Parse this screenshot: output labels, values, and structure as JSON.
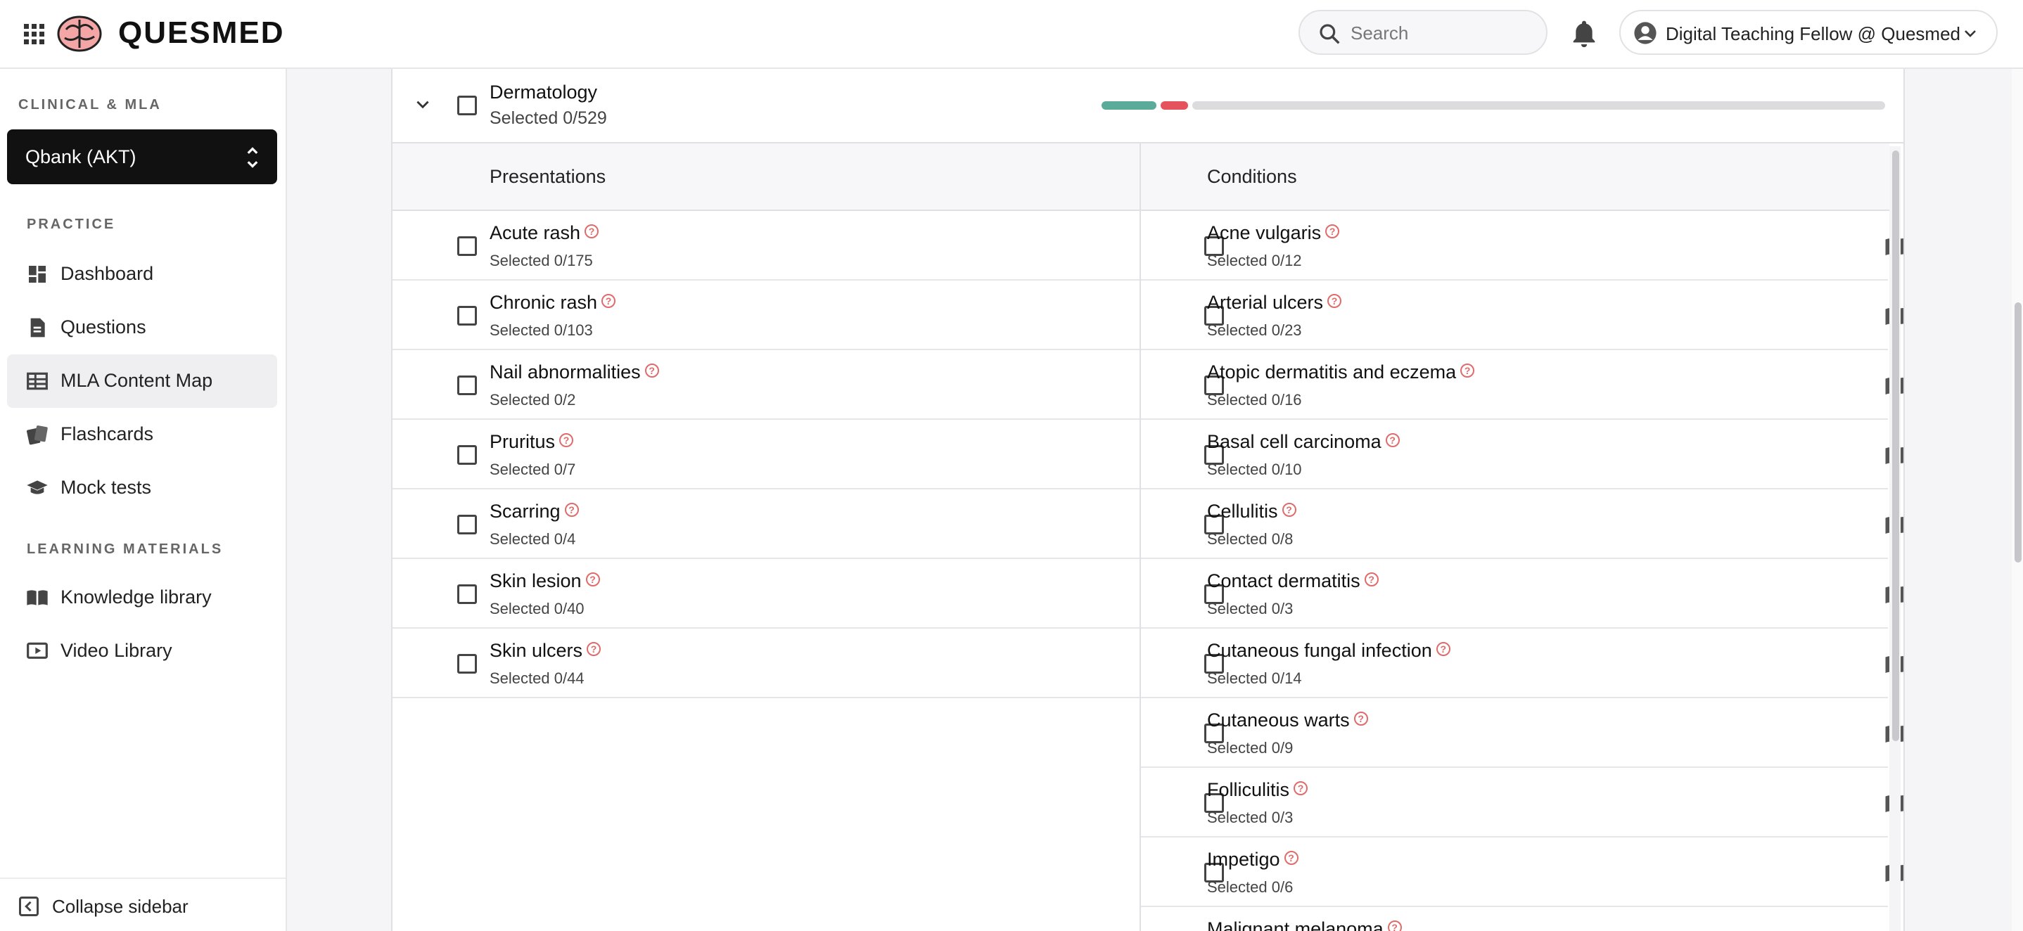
{
  "header": {
    "brand": "QUESMED",
    "search_placeholder": "Search",
    "account_label": "Digital Teaching Fellow @ Quesmed"
  },
  "sidebar": {
    "section_clinical": "CLINICAL & MLA",
    "qbank_label": "Qbank (AKT)",
    "section_practice": "PRACTICE",
    "practice_items": [
      {
        "label": "Dashboard",
        "icon": "dashboard-icon"
      },
      {
        "label": "Questions",
        "icon": "document-icon"
      },
      {
        "label": "MLA Content Map",
        "icon": "table-icon",
        "active": true
      },
      {
        "label": "Flashcards",
        "icon": "cards-icon"
      },
      {
        "label": "Mock tests",
        "icon": "graduation-cap-icon"
      }
    ],
    "section_learning": "LEARNING MATERIALS",
    "learning_items": [
      {
        "label": "Knowledge library",
        "icon": "book-icon"
      },
      {
        "label": "Video Library",
        "icon": "video-icon"
      }
    ],
    "collapse_label": "Collapse sidebar"
  },
  "accordion": {
    "title": "Dermatology",
    "selected": "Selected 0/529",
    "progress": {
      "correct_fraction": 0.07,
      "incorrect_fraction": 0.035,
      "colors": {
        "correct": "#5aab9a",
        "incorrect": "#e5545c",
        "remaining": "#dcdcdf"
      }
    }
  },
  "columns": {
    "presentations": "Presentations",
    "conditions": "Conditions"
  },
  "presentations": [
    {
      "name": "Acute rash",
      "selected": "Selected 0/175"
    },
    {
      "name": "Chronic rash",
      "selected": "Selected 0/103"
    },
    {
      "name": "Nail abnormalities",
      "selected": "Selected 0/2"
    },
    {
      "name": "Pruritus",
      "selected": "Selected 0/7"
    },
    {
      "name": "Scarring",
      "selected": "Selected 0/4"
    },
    {
      "name": "Skin lesion",
      "selected": "Selected 0/40"
    },
    {
      "name": "Skin ulcers",
      "selected": "Selected 0/44"
    }
  ],
  "conditions": [
    {
      "name": "Acne vulgaris",
      "selected": "Selected 0/12"
    },
    {
      "name": "Arterial ulcers",
      "selected": "Selected 0/23"
    },
    {
      "name": "Atopic dermatitis and eczema",
      "selected": "Selected 0/16"
    },
    {
      "name": "Basal cell carcinoma",
      "selected": "Selected 0/10"
    },
    {
      "name": "Cellulitis",
      "selected": "Selected 0/8"
    },
    {
      "name": "Contact dermatitis",
      "selected": "Selected 0/3"
    },
    {
      "name": "Cutaneous fungal infection",
      "selected": "Selected 0/14"
    },
    {
      "name": "Cutaneous warts",
      "selected": "Selected 0/9"
    },
    {
      "name": "Folliculitis",
      "selected": "Selected 0/3"
    },
    {
      "name": "Impetigo",
      "selected": "Selected 0/6"
    },
    {
      "name": "Malignant melanoma",
      "selected": ""
    }
  ]
}
